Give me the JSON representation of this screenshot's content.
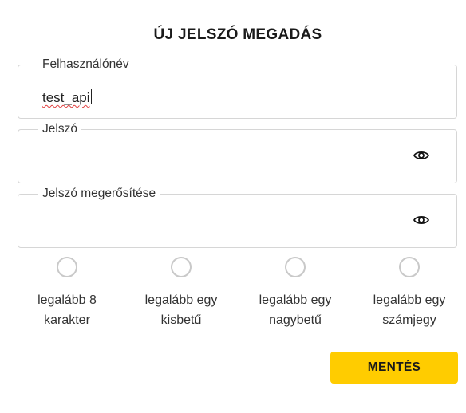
{
  "page": {
    "title": "ÚJ JELSZÓ MEGADÁS"
  },
  "fields": {
    "username": {
      "label": "Felhasználónév",
      "value": "test_api"
    },
    "password": {
      "label": "Jelszó",
      "value": "",
      "toggle_icon": "eye-icon"
    },
    "password_confirm": {
      "label": "Jelszó megerősítése",
      "value": "",
      "toggle_icon": "eye-icon"
    }
  },
  "requirements": [
    {
      "text": "legalább 8\nkarakter",
      "met": false
    },
    {
      "text": "legalább egy\nkisbetű",
      "met": false
    },
    {
      "text": "legalább egy\nnagybetű",
      "met": false
    },
    {
      "text": "legalább egy\nszámjegy",
      "met": false
    }
  ],
  "actions": {
    "save_label": "MENTÉS"
  },
  "colors": {
    "accent": "#ffcc00",
    "border": "#d6d6d6",
    "indicator_inactive": "#c9c9c9"
  }
}
